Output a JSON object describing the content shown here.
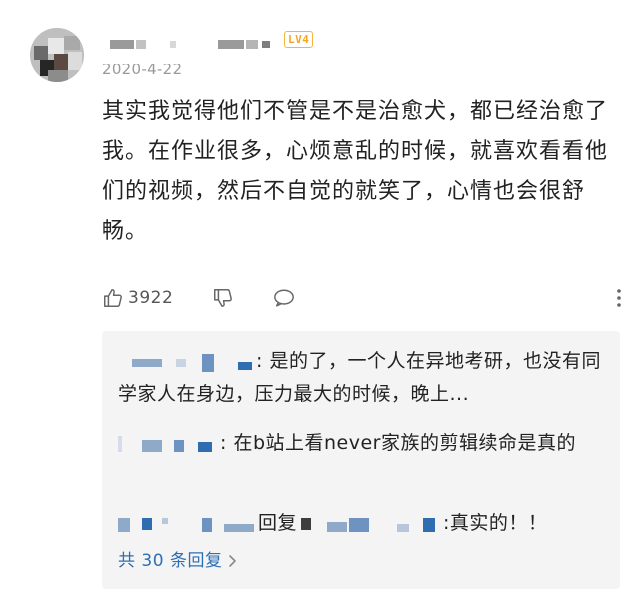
{
  "comment": {
    "level_badge": "LV4",
    "date": "2020-4-22",
    "text": "其实我觉得他们不管是不是治愈犬，都已经治愈了我。在作业很多，心烦意乱的时候，就喜欢看看他们的视频，然后不自觉的就笑了，心情也会很舒畅。"
  },
  "actions": {
    "like_count": "3922",
    "icons": [
      "thumbs-up-icon",
      "thumbs-down-icon",
      "comment-bubble-icon",
      "more-vertical-icon"
    ]
  },
  "replies": [
    {
      "text": ": 是的了，一个人在异地考研，也没有同学家人在身边，压力最大的时候，晚上..."
    },
    {
      "text": ": 在b站上看never家族的剪辑续命是真的"
    },
    {
      "reply_word": "回复",
      "text": ":真实的！！"
    }
  ],
  "more_replies": {
    "label": "共 30 条回复",
    "icon": "chevron-right-icon"
  },
  "colors": {
    "badge": "#f4a623",
    "link": "#2d6fb3",
    "reply_bg": "#f4f4f5",
    "muted": "#9a9a9a"
  }
}
